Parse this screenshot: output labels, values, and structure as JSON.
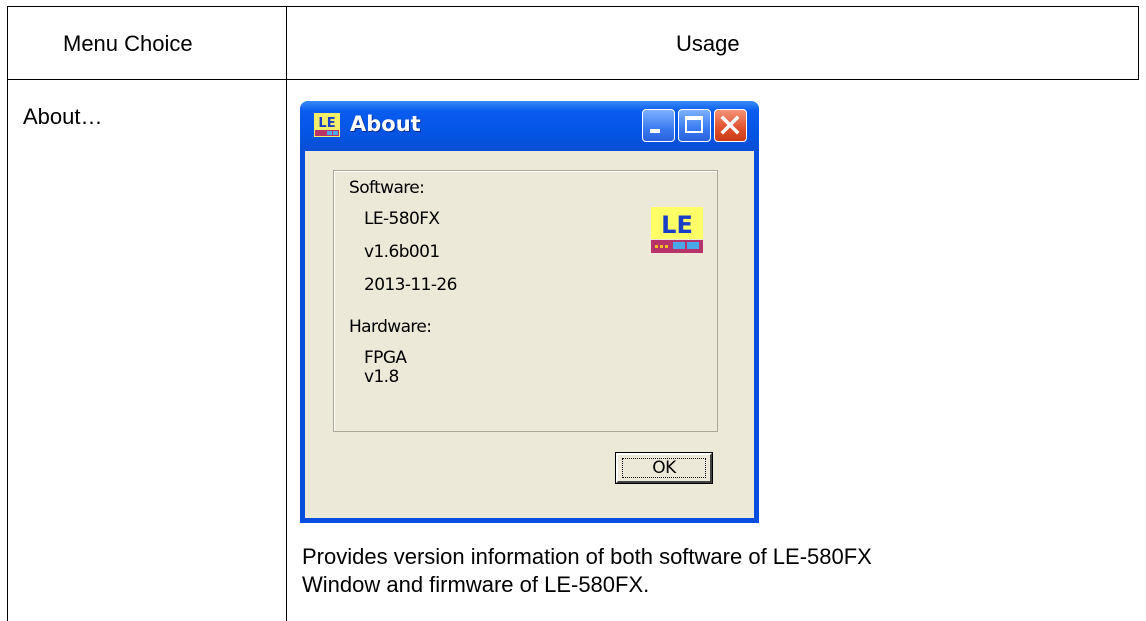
{
  "table": {
    "header_menu": "Menu Choice",
    "header_usage": "Usage",
    "row_menu": "About…",
    "description_line1": "Provides version information of both software of LE-580FX",
    "description_line2": "Window and firmware of LE-580FX."
  },
  "dialog": {
    "title": "About",
    "software_label": "Software:",
    "software_name": "LE-580FX",
    "software_version": "v1.6b001",
    "software_date": "2013-11-26",
    "hardware_label": "Hardware:",
    "hardware_name": "FPGA",
    "hardware_version": "v1.8",
    "ok_label": "OK",
    "logo_text": "LE",
    "icon_text": "LE"
  },
  "colors": {
    "titlebar": "#0a5cf0",
    "client": "#ece9d8",
    "close_button": "#e0502c",
    "logo_yellow": "#ffff66",
    "logo_bar": "#b8336a"
  },
  "icons": {
    "minimize": "minimize-icon",
    "maximize": "maximize-icon",
    "close": "close-icon",
    "app": "app-icon"
  }
}
